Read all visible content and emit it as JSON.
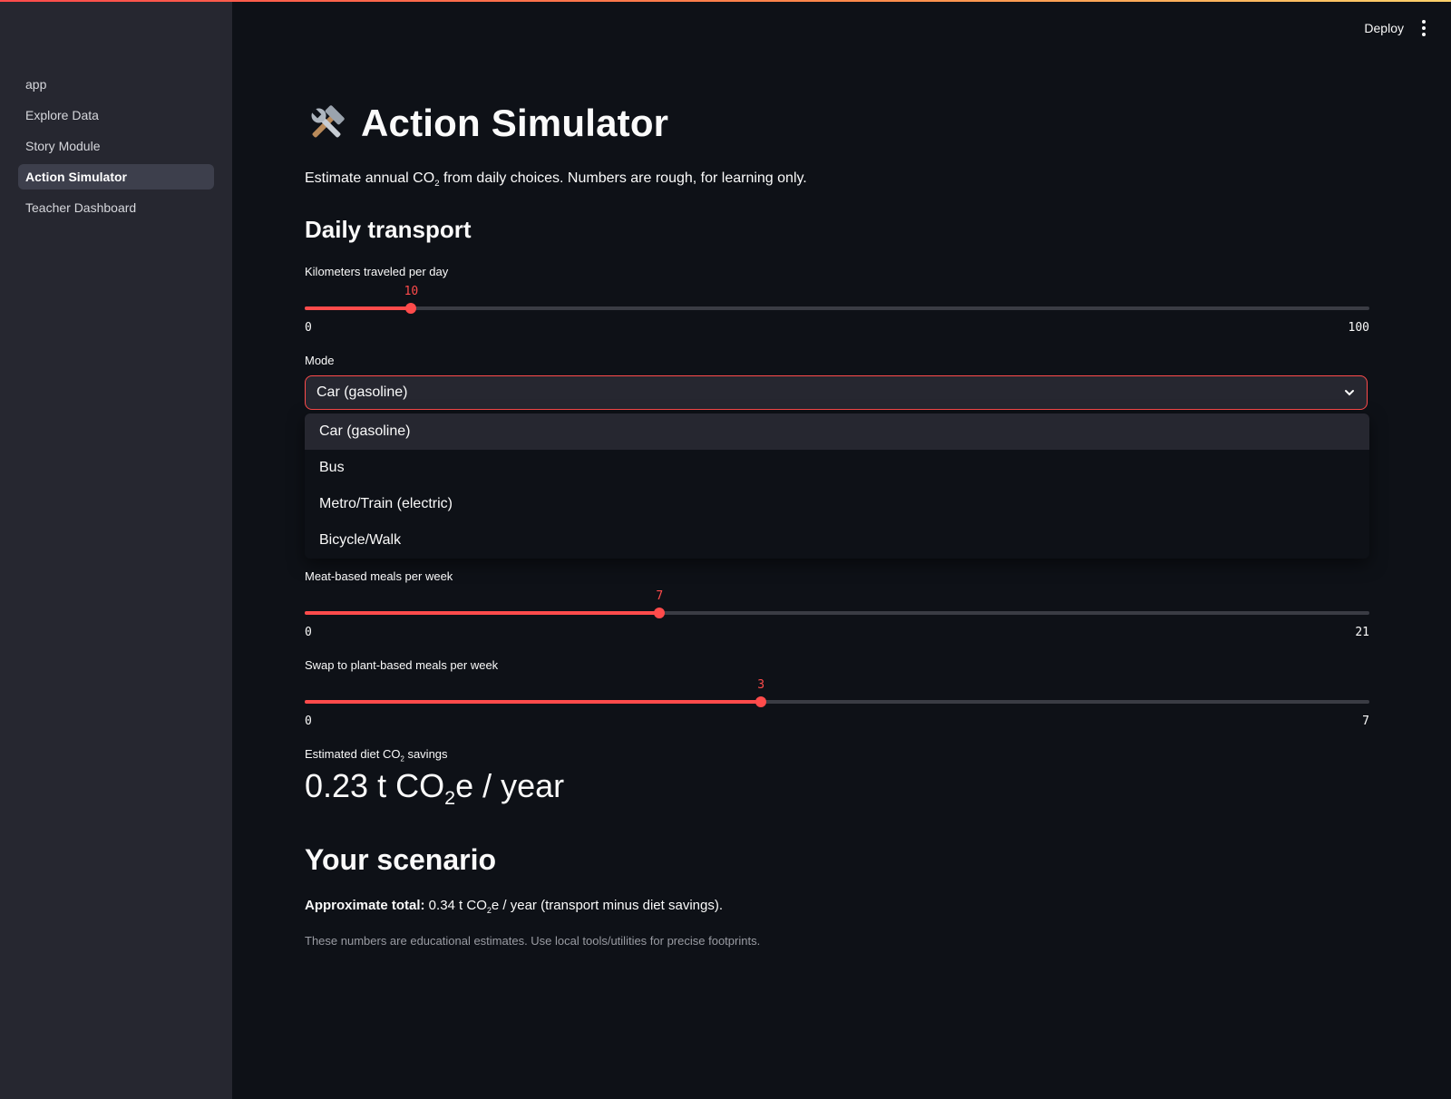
{
  "sidebar": {
    "items": [
      {
        "label": "app"
      },
      {
        "label": "Explore Data"
      },
      {
        "label": "Story Module"
      },
      {
        "label": "Action Simulator",
        "active": true
      },
      {
        "label": "Teacher Dashboard"
      }
    ]
  },
  "header": {
    "deploy_label": "Deploy"
  },
  "page": {
    "title": "Action Simulator",
    "caption_pre": "Estimate annual CO",
    "caption_sub": "2",
    "caption_post": " from daily choices. Numbers are rough, for learning only.",
    "icon": "hammer-and-wrench-icon"
  },
  "transport": {
    "heading": "Daily transport",
    "km_label": "Kilometers traveled per day",
    "km_slider": {
      "min": 0,
      "max": 100,
      "value": 10
    },
    "mode_label": "Mode",
    "mode_value": "Car (gasoline)",
    "mode_options": [
      "Car (gasoline)",
      "Bus",
      "Metro/Train (electric)",
      "Bicycle/Walk"
    ]
  },
  "diet": {
    "meat_label": "Meat-based meals per week",
    "meat_slider": {
      "min": 0,
      "max": 21,
      "value": 7
    },
    "swap_label": "Swap to plant-based meals per week",
    "swap_slider": {
      "min": 0,
      "max": 7,
      "value": 3
    },
    "metric_label_pre": "Estimated diet CO",
    "metric_label_sub": "2",
    "metric_label_post": " savings",
    "metric_value_pre": "0.23 t CO",
    "metric_value_sub": "2",
    "metric_value_post": "e / year"
  },
  "scenario": {
    "heading": "Your scenario",
    "total_bold": "Approximate total:",
    "total_pre": " 0.34 t CO",
    "total_sub": "2",
    "total_post": "e / year (transport minus diet savings).",
    "note": "These numbers are educational estimates. Use local tools/utilities for precise footprints."
  },
  "colors": {
    "accent": "#ff4b4b",
    "background": "#0e1117",
    "sidebar": "#262730"
  }
}
